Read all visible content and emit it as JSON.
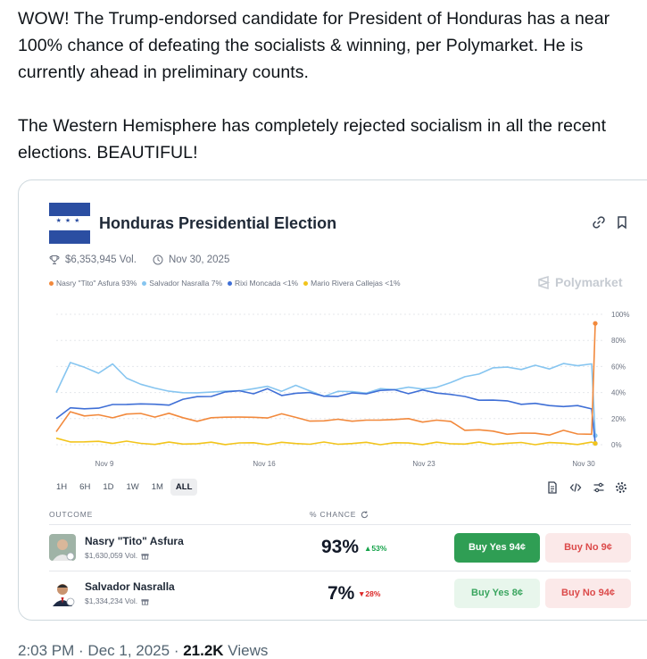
{
  "tweet": {
    "paragraph_1": "WOW! The Trump-endorsed candidate for President of Honduras has a near 100% chance of defeating the socialists & winning, per Polymarket. He is currently ahead in preliminary counts.",
    "paragraph_2": "The Western Hemisphere has completely rejected socialism in all the recent elections. BEAUTIFUL!"
  },
  "card": {
    "title": "Honduras Presidential Election",
    "volume": "$6,353,945 Vol.",
    "date": "Nov 30, 2025",
    "watermark": "Polymarket",
    "legend": [
      {
        "label": "Nasry \"Tito\" Asfura 93%",
        "color": "#f2893c"
      },
      {
        "label": "Salvador Nasralla 7%",
        "color": "#86c5f0"
      },
      {
        "label": "Rixi Moncada <1%",
        "color": "#3f6fd6"
      },
      {
        "label": "Mario Rivera Callejas <1%",
        "color": "#f2c41b"
      }
    ],
    "ranges": [
      "1H",
      "6H",
      "1D",
      "1W",
      "1M",
      "ALL"
    ],
    "active_range": "ALL",
    "headers": {
      "outcome": "OUTCOME",
      "chance": "% CHANCE"
    },
    "candidates": [
      {
        "name": "Nasry \"Tito\" Asfura",
        "volume": "$1,630,059 Vol.",
        "chance": "93%",
        "change": "▲53%",
        "change_dir": "up",
        "yes": "Buy Yes 94¢",
        "no": "Buy No 9¢"
      },
      {
        "name": "Salvador Nasralla",
        "volume": "$1,334,234 Vol.",
        "chance": "7%",
        "change": "▼28%",
        "change_dir": "down",
        "yes": "Buy Yes 8¢",
        "no": "Buy No 94¢"
      }
    ]
  },
  "chart_data": {
    "type": "line",
    "x_tick_labels": [
      "Nov 9",
      "Nov 16",
      "Nov 23",
      "Nov 30"
    ],
    "y_tick_labels": [
      "100%",
      "80%",
      "60%",
      "40%",
      "20%",
      "0%"
    ],
    "ylim": [
      0,
      100
    ],
    "grid": true,
    "series": [
      {
        "name": "Salvador Nasralla",
        "color": "#86c5f0",
        "values": [
          40,
          62,
          60,
          55,
          61,
          52,
          46,
          43,
          42,
          39,
          40,
          41,
          40,
          42,
          43,
          44,
          42,
          45,
          41,
          38,
          40,
          41,
          40,
          42,
          43,
          44,
          42,
          45,
          47,
          52,
          55,
          58,
          60,
          58,
          60,
          59,
          62,
          60,
          63,
          7
        ]
      },
      {
        "name": "Rixi Moncada",
        "color": "#3f6fd6",
        "values": [
          20,
          28,
          27,
          29,
          30,
          31,
          32,
          30,
          31,
          35,
          36,
          38,
          40,
          41,
          40,
          42,
          38,
          40,
          39,
          38,
          37,
          39,
          40,
          41,
          42,
          40,
          41,
          40,
          39,
          36,
          35,
          34,
          33,
          32,
          31,
          30,
          30,
          29,
          28,
          1
        ]
      },
      {
        "name": "Nasry \"Tito\" Asfura",
        "color": "#f2893c",
        "values": [
          10,
          25,
          23,
          22,
          21,
          24,
          23,
          22,
          24,
          20,
          19,
          20,
          21,
          22,
          20,
          21,
          24,
          20,
          19,
          18,
          19,
          19,
          18,
          19,
          20,
          19,
          18,
          19,
          17,
          12,
          11,
          10,
          9,
          8,
          9,
          8,
          10,
          9,
          8,
          93
        ]
      },
      {
        "name": "Mario Rivera Callejas",
        "color": "#f2c41b",
        "values": [
          5,
          3,
          2,
          2,
          2,
          2,
          1,
          1,
          1,
          1,
          1,
          1,
          1,
          1,
          1,
          1,
          1,
          1,
          1,
          1,
          1,
          1,
          1,
          1,
          1,
          1,
          1,
          1,
          1,
          1,
          1,
          1,
          1,
          1,
          1,
          1,
          1,
          1,
          1,
          1
        ]
      }
    ]
  },
  "footer": {
    "time": "2:03 PM · Dec 1, 2025 · ",
    "views_count": "21.2K",
    "views_label": " Views"
  }
}
